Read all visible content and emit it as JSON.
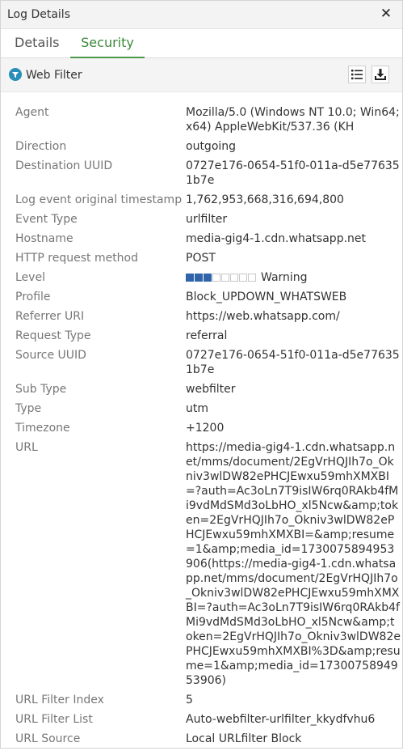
{
  "window": {
    "title": "Log Details",
    "close_glyph": "✕"
  },
  "tabs": [
    {
      "label": "Details",
      "active": false
    },
    {
      "label": "Security",
      "active": true
    }
  ],
  "section": {
    "title": "Web Filter",
    "icon": "filter-icon",
    "buttons": [
      "list-icon",
      "download-icon"
    ]
  },
  "colors": {
    "active_tab": "#3b8a3b",
    "level_fill": "#2f64a8"
  },
  "level": {
    "filled_segments": 3,
    "total_segments": 8,
    "label": "Warning"
  },
  "fields": [
    {
      "label": "Agent",
      "value": "Mozilla/5.0 (Windows NT 10.0; Win64; x64) AppleWebKit/537.36 (KH"
    },
    {
      "label": "Direction",
      "value": "outgoing"
    },
    {
      "label": "Destination UUID",
      "value": "0727e176-0654-51f0-011a-d5e776351b7e"
    },
    {
      "label": "Log event original timestamp",
      "value": "1,762,953,668,316,694,800"
    },
    {
      "label": "Event Type",
      "value": "urlfilter"
    },
    {
      "label": "Hostname",
      "value": "media-gig4-1.cdn.whatsapp.net"
    },
    {
      "label": "HTTP request method",
      "value": "POST"
    },
    {
      "label": "Level",
      "value": "Warning"
    },
    {
      "label": "Profile",
      "value": "Block_UPDOWN_WHATSWEB"
    },
    {
      "label": "Referrer URI",
      "value": "https://web.whatsapp.com/"
    },
    {
      "label": "Request Type",
      "value": "referral"
    },
    {
      "label": "Source UUID",
      "value": "0727e176-0654-51f0-011a-d5e776351b7e"
    },
    {
      "label": "Sub Type",
      "value": "webfilter"
    },
    {
      "label": "Type",
      "value": "utm"
    },
    {
      "label": "Timezone",
      "value": "+1200"
    },
    {
      "label": "URL",
      "value": "https://media-gig4-1.cdn.whatsapp.net/mms/document/2EgVrHQJIh7o_Okniv3wlDW82ePHCJEwxu59mhXMXBI=?auth=Ac3oLn7T9isIW6rq0RAkb4fMi9vdMdSMd3oLbHO_xl5Ncw&amp;token=2EgVrHQJIh7o_Okniv3wlDW82ePHCJEwxu59mhXMXBI=&amp;resume=1&amp;media_id=1730075894953906(https://media-gig4-1.cdn.whatsapp.net/mms/document/2EgVrHQJIh7o_Okniv3wlDW82ePHCJEwxu59mhXMXBI=?auth=Ac3oLn7T9isIW6rq0RAkb4fMi9vdMdSMd3oLbHO_xl5Ncw&amp;token=2EgVrHQJIh7o_Okniv3wlDW82ePHCJEwxu59mhXMXBI%3D&amp;resume=1&amp;media_id=1730075894953906)"
    },
    {
      "label": "URL Filter Index",
      "value": "5"
    },
    {
      "label": "URL Filter List",
      "value": "Auto-webfilter-urlfilter_kkydfvhu6"
    },
    {
      "label": "URL Source",
      "value": "Local URLfilter Block"
    }
  ]
}
